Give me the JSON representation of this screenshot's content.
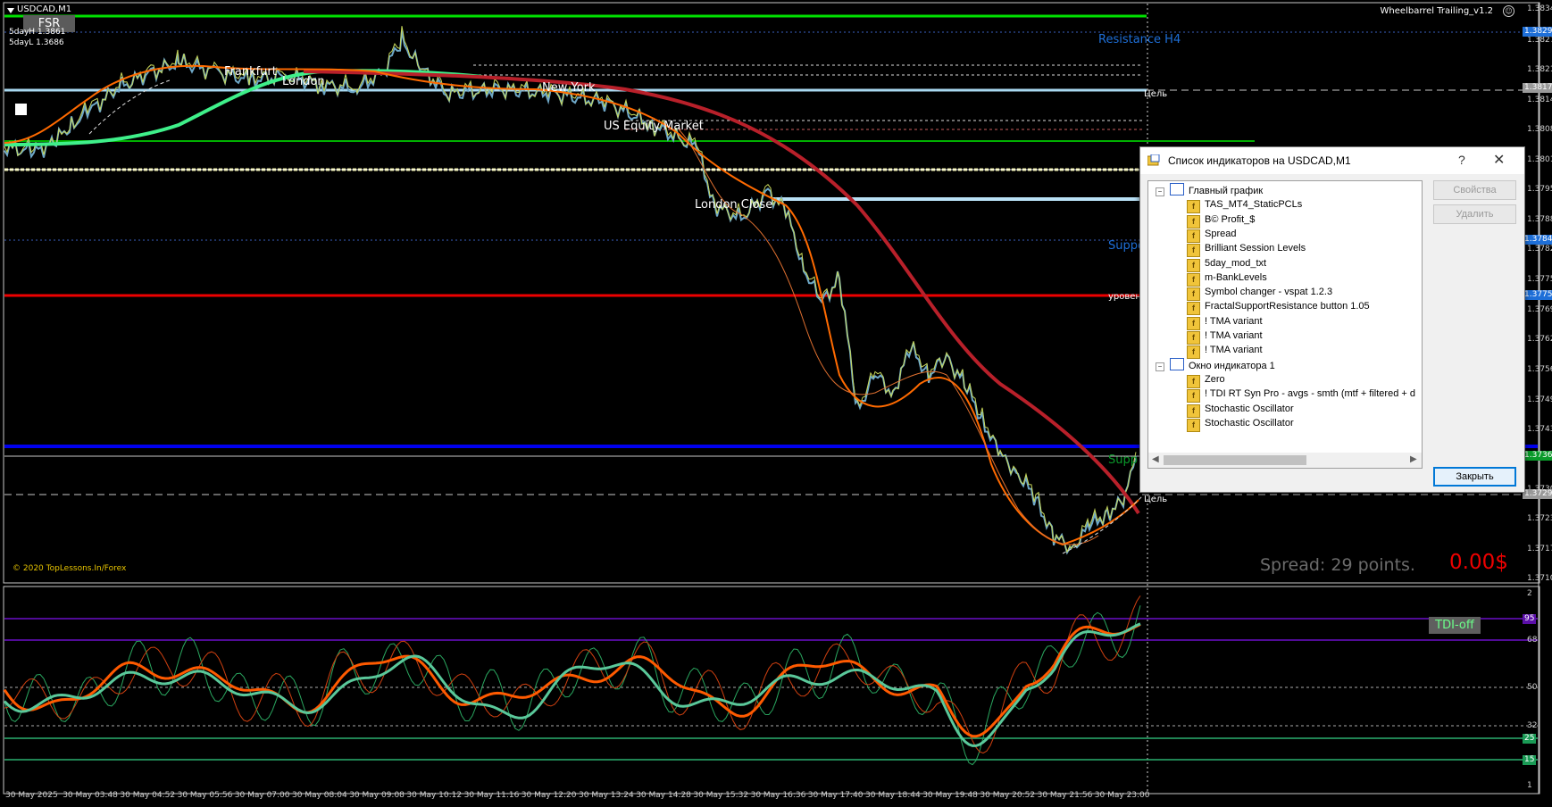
{
  "chart": {
    "symbol_title": "USDCAD,M1",
    "fsr_button": "FSR",
    "five_day_high": "5dayH 1.3861",
    "five_day_low": "5dayL 1.3686",
    "copyright": "© 2020 TopLessons.In/Forex",
    "expert_name": "Wheelbarrel Trailing_v1.2",
    "expert_face": "☺",
    "sessions": [
      "Frankfurt",
      "London",
      "New York",
      "US Equity Market",
      "London Close"
    ],
    "levels": {
      "resistance_h4": "Resistance H4",
      "target_top": "Цель",
      "support": "Suppo",
      "level": "уровен",
      "support_bottom": "Supp",
      "target_bottom": "Цель"
    },
    "spread_text": "Spread: 29 points.",
    "profit_text": "0.00$",
    "price_axis": [
      "1.38340",
      "1.38275",
      "1.38210",
      "1.38145",
      "1.38080",
      "1.38015",
      "1.37950",
      "1.37885",
      "1.37820",
      "1.37755",
      "1.37690",
      "1.37625",
      "1.37560",
      "1.37495",
      "1.37430",
      "1.37365",
      "1.37300",
      "1.37235",
      "1.37170",
      "1.37105"
    ],
    "price_tags": [
      {
        "text": "1.38291",
        "bg": "#1e6fd8"
      },
      {
        "text": "1.38170",
        "bg": "#9a9a9a"
      },
      {
        "text": "1.37843",
        "bg": "#1e6fd8"
      },
      {
        "text": "1.37755",
        "bg": "#1e6fd8"
      },
      {
        "text": "1.37368",
        "bg": "#0a9a2a"
      },
      {
        "text": "1.37294",
        "bg": "#9a9a9a"
      }
    ]
  },
  "indicator": {
    "button": "TDI-off",
    "axis": [
      "2",
      "68",
      "50",
      "32",
      "1"
    ],
    "tags": [
      {
        "text": "95",
        "bg": "#5b0fa8"
      },
      {
        "text": "25",
        "bg": "#1a9a55"
      },
      {
        "text": "15",
        "bg": "#1a9a55"
      }
    ]
  },
  "time_axis": [
    "30 May 2025",
    "30 May 03:48",
    "30 May 04:52",
    "30 May 05:56",
    "30 May 07:00",
    "30 May 08:04",
    "30 May 09:08",
    "30 May 10:12",
    "30 May 11:16",
    "30 May 12:20",
    "30 May 13:24",
    "30 May 14:28",
    "30 May 15:32",
    "30 May 16:36",
    "30 May 17:40",
    "30 May 18:44",
    "30 May 19:48",
    "30 May 20:52",
    "30 May 21:56",
    "30 May 23:00"
  ],
  "dialog": {
    "title": "Список индикаторов на USDCAD,M1",
    "help": "?",
    "close": "✕",
    "tree": [
      {
        "type": "group",
        "label": "Главный график"
      },
      {
        "type": "item",
        "label": "TAS_MT4_StaticPCLs"
      },
      {
        "type": "item",
        "label": "B© Profit_$"
      },
      {
        "type": "item",
        "label": "Spread"
      },
      {
        "type": "item",
        "label": "Brilliant Session Levels"
      },
      {
        "type": "item",
        "label": "5day_mod_txt"
      },
      {
        "type": "item",
        "label": "m-BankLevels"
      },
      {
        "type": "item",
        "label": "Symbol changer - vspat 1.2.3"
      },
      {
        "type": "item",
        "label": "FractalSupportResistance button 1.05"
      },
      {
        "type": "item",
        "label": "! TMA variant"
      },
      {
        "type": "item",
        "label": "! TMA variant"
      },
      {
        "type": "item",
        "label": "! TMA variant"
      },
      {
        "type": "group",
        "label": "Окно индикатора 1"
      },
      {
        "type": "item",
        "label": "Zero"
      },
      {
        "type": "item",
        "label": "! TDI RT Syn Pro - avgs - smth  (mtf + filtered + d"
      },
      {
        "type": "item",
        "label": "Stochastic Oscillator"
      },
      {
        "type": "item",
        "label": "Stochastic Oscillator"
      }
    ],
    "buttons": {
      "properties": "Свойства",
      "delete": "Удалить",
      "close": "Закрыть"
    }
  },
  "colors": {
    "background": "#000000",
    "tma_slow": "#b8202a",
    "tma_fast": "#ff6a00",
    "accent_green": "#32e07a",
    "resistance_blue": "#0000ee",
    "support_red": "#ee0000"
  }
}
